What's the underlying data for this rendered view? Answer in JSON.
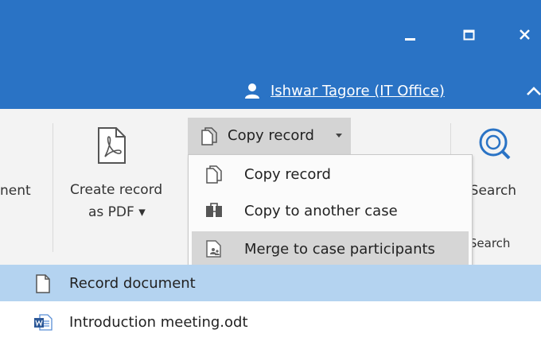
{
  "window": {
    "user_name": "Ishwar Tagore (IT Office)"
  },
  "ribbon": {
    "partial_left_label": "nent",
    "create_pdf": {
      "line1": "Create record",
      "line2": "as PDF ▾"
    },
    "copy_record_button": "Copy record",
    "search": {
      "label": "tSearch",
      "group_label": "tSearch"
    }
  },
  "copy_menu": {
    "items": [
      {
        "label": "Copy record",
        "icon": "copy-icon"
      },
      {
        "label": "Copy to another case",
        "icon": "case-transfer-icon"
      },
      {
        "label": "Merge to case participants",
        "icon": "merge-participants-icon"
      }
    ]
  },
  "documents": {
    "rows": [
      {
        "label": "Record document",
        "icon": "document-icon",
        "selected": true
      },
      {
        "label": "Introduction meeting.odt",
        "icon": "word-document-icon",
        "selected": false
      }
    ]
  },
  "colors": {
    "title_bar": "#2a73c5",
    "selection": "#b4d3f0",
    "ribbon_bg": "#f3f3f3"
  }
}
